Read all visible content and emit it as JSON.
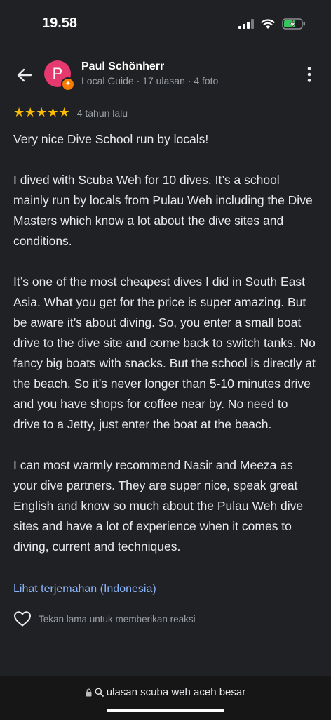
{
  "status_bar": {
    "time": "19.58"
  },
  "header": {
    "avatar_letter": "P",
    "author_name": "Paul Schönherr",
    "author_meta": "Local Guide · 17 ulasan · 4 foto"
  },
  "review": {
    "stars": "★★★★★",
    "rating": 5,
    "age": "4 tahun lalu",
    "paragraphs": [
      "Very nice Dive School run by locals!",
      "I dived with Scuba Weh for 10 dives. It’s a school mainly run by locals from Pulau Weh including the Dive Masters which know a lot about the dive sites and conditions.",
      "It’s one of the most cheapest dives I did in South East Asia. What you get for the price is super amazing. But be aware it’s about diving. So, you enter a small boat drive to the dive site and come back to switch tanks. No fancy big boats with snacks. But the school is directly at the beach. So it’s never longer than 5-10 minutes drive and you have shops for coffee near by. No need to drive to a Jetty, just enter the boat at the beach.",
      "I can most warmly recommend Nasir and Meeza as your dive partners. They are super nice, speak great English and know so much about the Pulau Weh dive sites and have a lot of experience when it comes to diving, current and techniques."
    ],
    "translate_link": "Lihat terjemahan (Indonesia)",
    "react_hint": "Tekan lama untuk memberikan reaksi"
  },
  "browser": {
    "url_text": "ulasan scuba weh aceh besar"
  },
  "colors": {
    "background": "#202124",
    "avatar": "#e53970",
    "star": "#fbbc04",
    "link": "#8ab4f8",
    "battery": "#34c759"
  },
  "icons": [
    "back-arrow-icon",
    "more-vert-icon",
    "heart-outline-icon",
    "lock-icon",
    "search-icon",
    "signal-icon",
    "wifi-icon",
    "battery-icon"
  ]
}
